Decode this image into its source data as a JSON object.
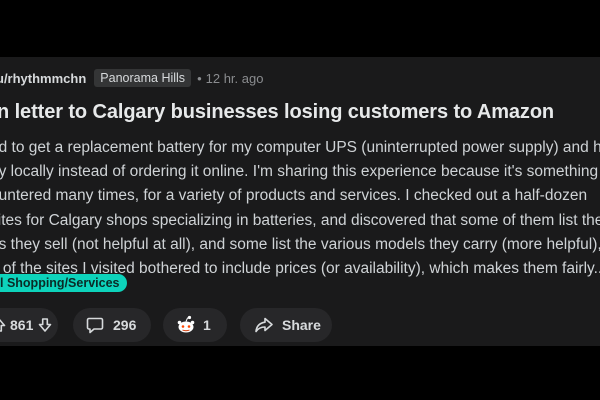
{
  "post": {
    "author": "u/rhythmmchn",
    "flair": "Panorama Hills",
    "separator": "•",
    "time": "12 hr. ago",
    "title": "en letter to Calgary businesses losing customers to Amazon",
    "body_lines": [
      "ed to get a replacement battery for my computer UPS (uninterrupted power supply) and ho",
      "uy locally instead of ordering it online. I'm sharing this experience because it's something I'",
      "ountered many times, for a variety of products and services. I checked out a half-dozen",
      "sites for Calgary shops specializing in batteries, and discovered that some of them list the",
      "ds they sell (not helpful at all), and some list the various models they carry (more helpful), I",
      "e of the sites I visited bothered to include prices (or availability), which makes them fairly..."
    ],
    "tag": "l Shopping/Services"
  },
  "actions": {
    "votes": "861",
    "comments": "296",
    "awards": "1",
    "share_label": "Share"
  },
  "colors": {
    "background": "#000000",
    "card": "#1a1a1b",
    "tag": "#0dd3bb",
    "pill": "#272729",
    "text": "#d7dadc",
    "muted": "#8a8c8f"
  },
  "icons": {
    "upvote": "upvote-icon",
    "downvote": "downvote-icon",
    "comment": "comment-icon",
    "award": "award-icon",
    "share": "share-icon"
  }
}
